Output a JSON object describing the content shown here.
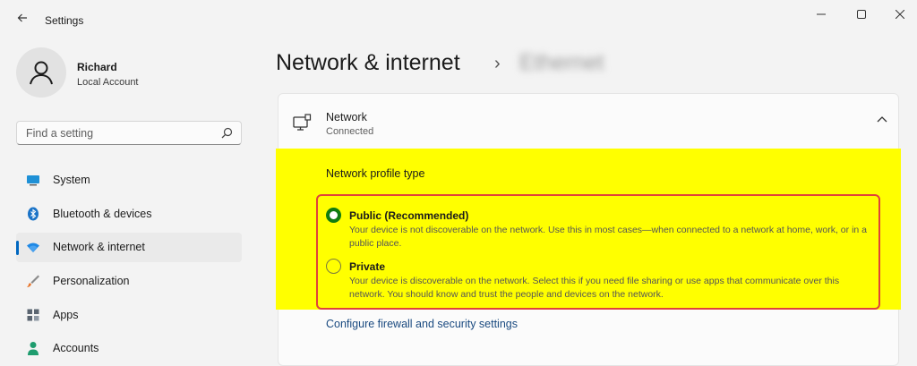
{
  "window": {
    "title": "Settings"
  },
  "profile": {
    "name": "Richard",
    "account_type": "Local Account"
  },
  "search": {
    "placeholder": "Find a setting"
  },
  "sidebar": {
    "items": [
      {
        "label": "System",
        "icon": "system-icon",
        "active": false
      },
      {
        "label": "Bluetooth & devices",
        "icon": "bluetooth-icon",
        "active": false
      },
      {
        "label": "Network & internet",
        "icon": "wifi-icon",
        "active": true
      },
      {
        "label": "Personalization",
        "icon": "brush-icon",
        "active": false
      },
      {
        "label": "Apps",
        "icon": "apps-icon",
        "active": false
      },
      {
        "label": "Accounts",
        "icon": "person-icon",
        "active": false
      }
    ]
  },
  "breadcrumb": {
    "parent": "Network & internet",
    "separator": "›",
    "current": "Ethernet"
  },
  "network_card": {
    "title": "Network",
    "status": "Connected",
    "profile_type_label": "Network profile type",
    "options": [
      {
        "title": "Public (Recommended)",
        "description": "Your device is not discoverable on the network. Use this in most cases—when connected to a network at home, work, or in a public place.",
        "selected": true
      },
      {
        "title": "Private",
        "description": "Your device is discoverable on the network. Select this if you need file sharing or use apps that communicate over this network. You should know and trust the people and devices on the network.",
        "selected": false
      }
    ],
    "firewall_link": "Configure firewall and security settings"
  },
  "colors": {
    "accent": "#0067c0",
    "highlight": "#ffff00",
    "annotation_border": "#e0423a",
    "radio_selected": "#107c10"
  }
}
